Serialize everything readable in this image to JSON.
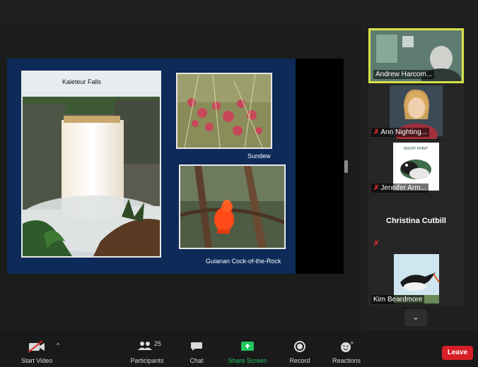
{
  "slide": {
    "captions": {
      "falls": "Kaieteur Falls",
      "sundew": "Sundew",
      "bird": "Guianan Cock-of-the-Rock"
    }
  },
  "participants_panel": {
    "tiles": [
      {
        "name": "Andrew Harcom...",
        "active": true,
        "muted": false
      },
      {
        "name": "Ann Nighting...",
        "muted": true
      },
      {
        "name": "Jennifer Arm...",
        "muted": true
      },
      {
        "name": "Christina Cutbill",
        "muted": true
      },
      {
        "name": "Kim Beardmore",
        "muted": false
      }
    ],
    "scroll_icon": "chevron-down-icon"
  },
  "toolbar": {
    "start_video": "Start Video",
    "participants": "Participants",
    "participant_count": "25",
    "chat": "Chat",
    "share_screen": "Share Screen",
    "record": "Record",
    "reactions": "Reactions",
    "leave": "Leave"
  },
  "colors": {
    "active_speaker_border": "#d7e24a",
    "share_screen_green": "#22c55e",
    "leave_red": "#d61f26",
    "slide_background": "#0d2a58"
  }
}
